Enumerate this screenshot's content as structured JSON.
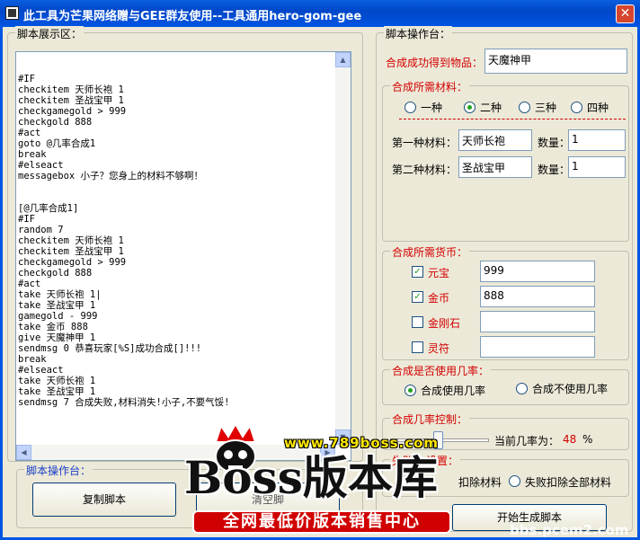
{
  "window": {
    "title": "此工具为芒果网络赠与GEE群友使用--工具通用hero-gom-gee"
  },
  "script_group": {
    "label": "脚本展示区："
  },
  "script_text": "#IF\ncheckitem 天师长袍 1\ncheckitem 圣战宝甲 1\ncheckgamegold > 999\ncheckgold 888\n#act\ngoto @几率合成1\nbreak\n#elseact\nmessagebox 小子？您身上的材料不够啊！\n\n\n[@几率合成1]\n#IF\nrandom 7\ncheckitem 天师长袍 1\ncheckitem 圣战宝甲 1\ncheckgamegold > 999\ncheckgold 888\n#act\ntake 天师长袍 1|\ntake 圣战宝甲 1\ngamegold - 999\ntake 金币 888\ngive 天魔神甲 1\nsendmsg 0 恭喜玩家[%S]成功合成[]!!!\nbreak\n#elseact\ntake 天师长袍 1\ntake 圣战宝甲 1\nsendmsg 7 合成失败,材料消失!小子,不要气馁!",
  "left_console": {
    "label": "脚本操作台：",
    "copy_button": "复制脚本",
    "middle_button_fragment": "清空脚"
  },
  "right_console": {
    "label": "脚本操作台：",
    "result_label": "合成成功得到物品：",
    "result_value": "天魔神甲",
    "materials": {
      "label": "合成所需材料：",
      "options": [
        "一种",
        "二种",
        "三种",
        "四种"
      ],
      "selected": 1,
      "first_label": "第一种材料：",
      "first_value": "天师长袍",
      "first_qty_label": "数量：",
      "first_qty": "1",
      "second_label": "第二种材料：",
      "second_value": "圣战宝甲",
      "second_qty_label": "数量：",
      "second_qty": "1"
    },
    "currency": {
      "label": "合成所需货币：",
      "items": [
        {
          "name": "元宝",
          "checked": true,
          "value": "999"
        },
        {
          "name": "金币",
          "checked": true,
          "value": "888"
        },
        {
          "name": "金刚石",
          "checked": false,
          "value": ""
        },
        {
          "name": "灵符",
          "checked": false,
          "value": ""
        }
      ]
    },
    "use_rate": {
      "label": "合成是否使用几率：",
      "options": [
        "合成使用几率",
        "合成不使用几率"
      ],
      "selected": 0
    },
    "rate_control": {
      "label": "合成几率控制：",
      "current_label": "当前几率为：",
      "current_value": "48",
      "unit": "%",
      "slider_fraction": 0.48
    },
    "fail_setting": {
      "label_fragment": "失败",
      "label_tail": "设置：",
      "options": [
        "扣除材料",
        "失败扣除全部材料"
      ],
      "selected": 0
    },
    "generate_button": "开始生成脚本"
  },
  "watermark": {
    "site": "www.789boss.com",
    "brand_a": "Boss",
    "brand_b": "版本库",
    "banner": "全网最低价版本销售中心",
    "url_fragment": "bbs.pcem2.com"
  },
  "colors": {
    "title_bar": "#0055e3",
    "label_red": "#d40000",
    "check_green": "#21a121"
  }
}
